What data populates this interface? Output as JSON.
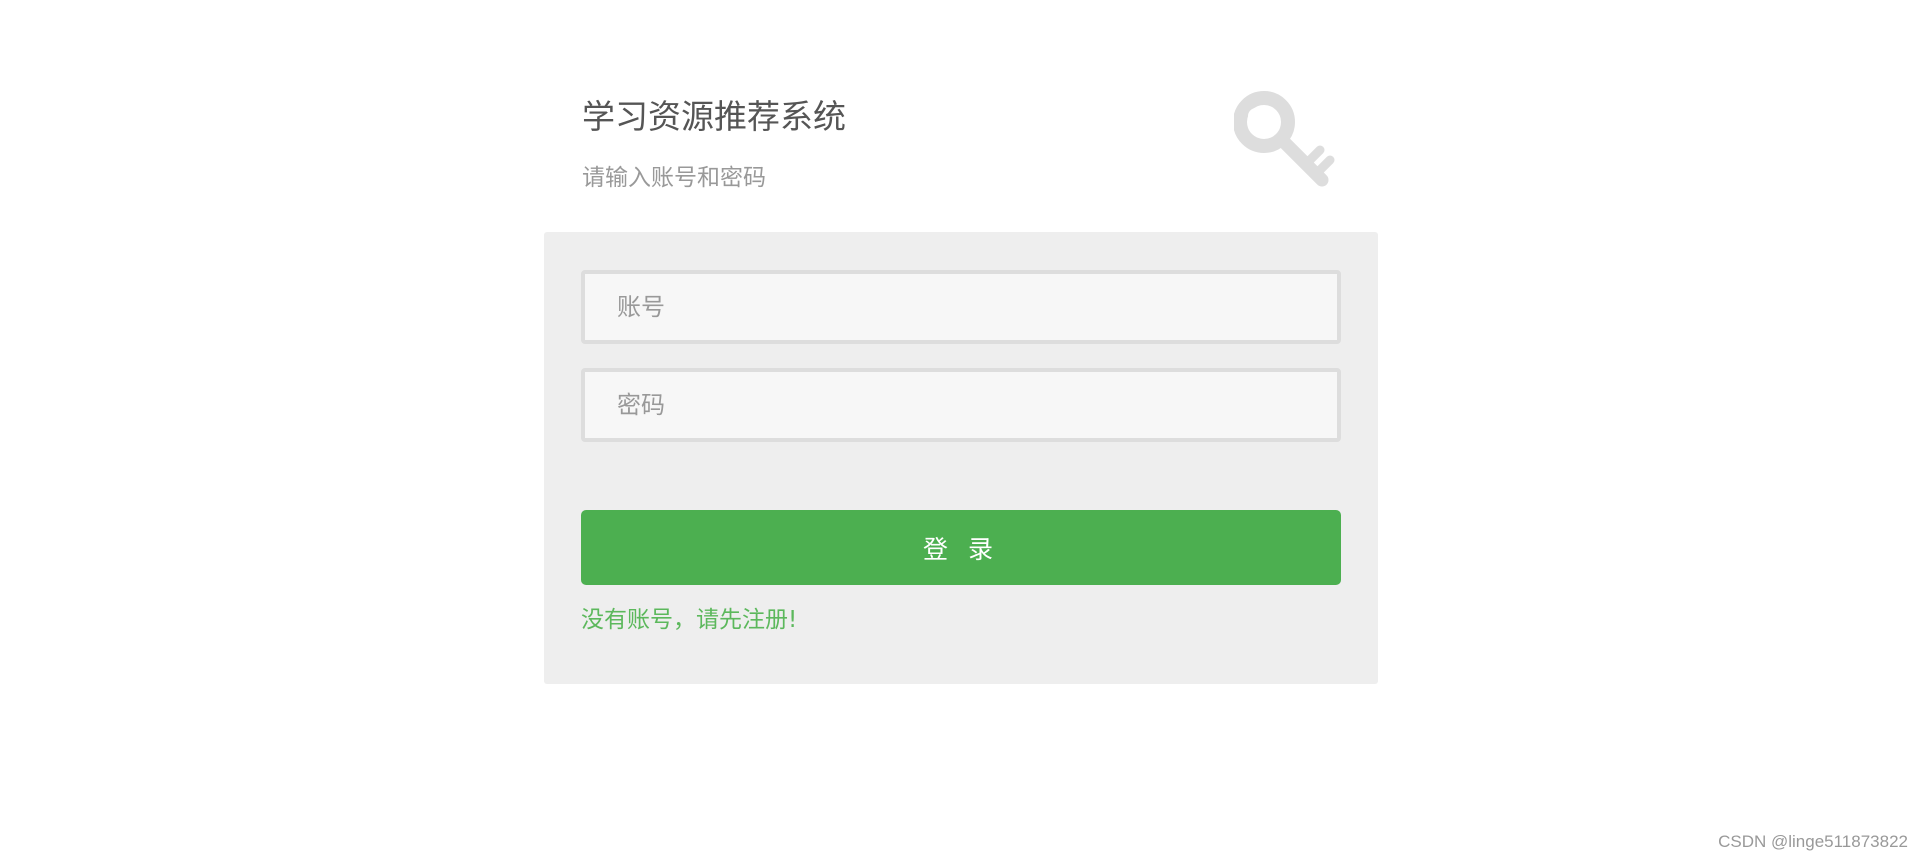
{
  "header": {
    "title": "学习资源推荐系统",
    "subtitle": "请输入账号和密码"
  },
  "form": {
    "account_placeholder": "账号",
    "password_placeholder": "密码",
    "login_label": "登 录",
    "register_link": "没有账号，请先注册!"
  },
  "footer": {
    "watermark": "CSDN @linge511873822"
  },
  "colors": {
    "accent": "#4caf50",
    "link": "#5cb85c",
    "panel": "#eeeeee"
  },
  "icons": {
    "header_icon": "key-icon"
  }
}
